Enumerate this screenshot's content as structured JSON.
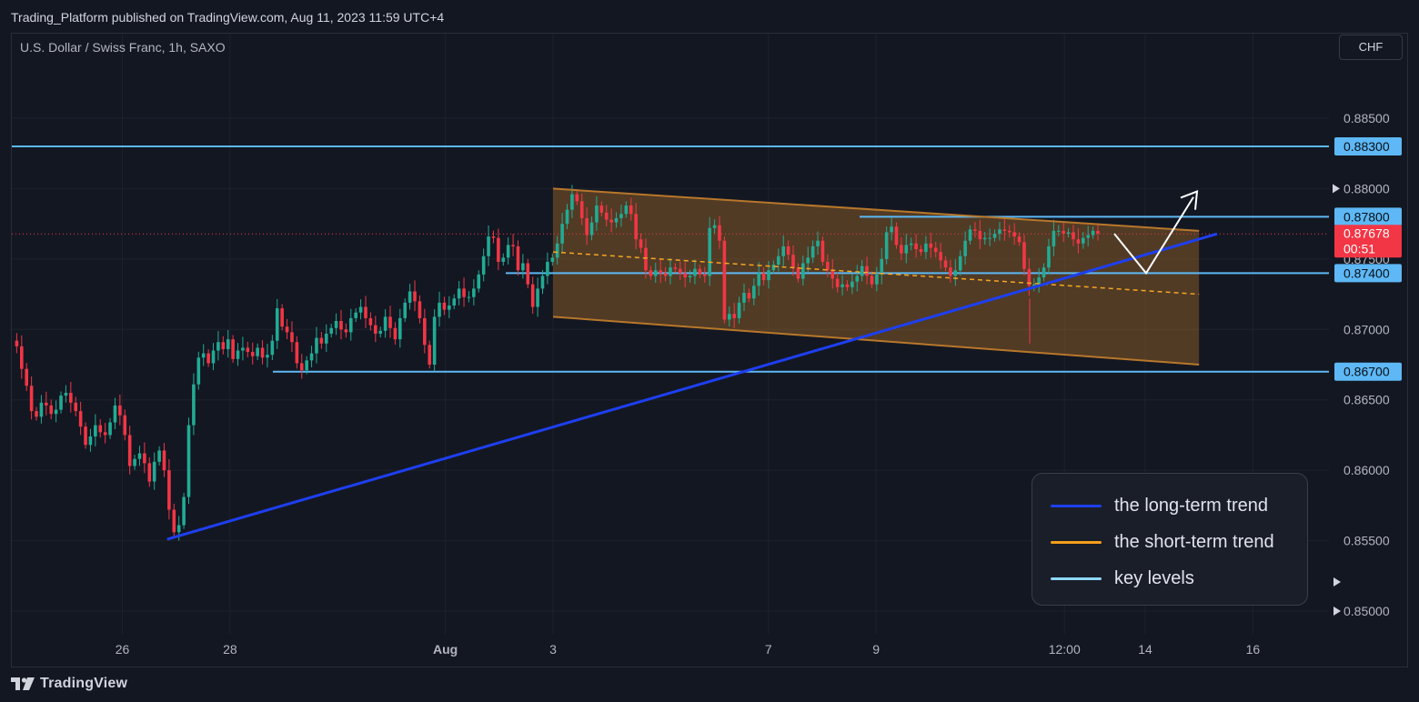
{
  "header": {
    "published_text": "Trading_Platform published on TradingView.com, Aug 11, 2023 11:59 UTC+4",
    "symbol_text": "U.S. Dollar / Swiss Franc, 1h, SAXO",
    "currency_label": "CHF"
  },
  "footer": {
    "brand": "TradingView"
  },
  "legend": {
    "items": [
      {
        "label": "the long-term trend",
        "color": "#1e3ff0"
      },
      {
        "label": "the short-term trend",
        "color": "#f59e1a"
      },
      {
        "label": "key levels",
        "color": "#8fd8ff"
      }
    ]
  },
  "colors": {
    "bull": "#22ab94",
    "bear": "#f23645",
    "key_level": "#5db8f5",
    "trend": "#1e3ff0",
    "channel": "#b8772a",
    "last_price": "#f23645"
  },
  "chart_data": {
    "type": "candlestick",
    "ylim": [
      0.8478,
      0.8897
    ],
    "y_ticks": [
      "0.88500",
      "0.88000",
      "0.87500",
      "0.87000",
      "0.86500",
      "0.86000",
      "0.85500",
      "0.85000"
    ],
    "x_ticks": [
      "26",
      "28",
      "Aug",
      "3",
      "7",
      "9",
      "12:00",
      "14",
      "16"
    ],
    "key_levels": [
      {
        "label": "0.88300",
        "value": 0.883
      },
      {
        "label": "0.87800",
        "value": 0.878
      },
      {
        "label": "0.87400",
        "value": 0.874
      },
      {
        "label": "0.86700",
        "value": 0.867
      }
    ],
    "last_price": {
      "label": "0.87678",
      "countdown": "00:51",
      "value": 0.87678
    },
    "trend_line": {
      "start": [
        "Jul 27",
        0.8551
      ],
      "end": [
        "Aug 14",
        0.8753
      ]
    },
    "channel": {
      "upper": [
        [
          "Aug 3",
          0.88
        ],
        [
          "Aug 15",
          0.877
        ]
      ],
      "lower": [
        [
          "Aug 3",
          0.8709
        ],
        [
          "Aug 15",
          0.8675
        ]
      ],
      "mid": [
        [
          "Aug 3",
          0.8755
        ],
        [
          "Aug 15",
          0.8725
        ]
      ]
    },
    "close_path": [
      0.8692,
      0.8688,
      0.8672,
      0.866,
      0.8642,
      0.8638,
      0.8648,
      0.8646,
      0.864,
      0.8643,
      0.8653,
      0.8655,
      0.8648,
      0.8642,
      0.8631,
      0.8618,
      0.8624,
      0.8632,
      0.8627,
      0.8625,
      0.8634,
      0.8646,
      0.8639,
      0.8625,
      0.8603,
      0.8608,
      0.8612,
      0.8605,
      0.8592,
      0.8606,
      0.8614,
      0.86,
      0.8572,
      0.8556,
      0.8561,
      0.8581,
      0.8632,
      0.8661,
      0.868,
      0.8683,
      0.8676,
      0.8685,
      0.8691,
      0.8686,
      0.8693,
      0.8679,
      0.8685,
      0.8687,
      0.8684,
      0.8681,
      0.8687,
      0.868,
      0.8682,
      0.8692,
      0.8715,
      0.8702,
      0.8698,
      0.8691,
      0.8676,
      0.8671,
      0.8678,
      0.8683,
      0.8694,
      0.869,
      0.8697,
      0.8701,
      0.8706,
      0.87,
      0.8698,
      0.8708,
      0.8712,
      0.8716,
      0.8708,
      0.8703,
      0.8697,
      0.8699,
      0.8709,
      0.8701,
      0.8693,
      0.8708,
      0.8719,
      0.8727,
      0.872,
      0.8708,
      0.8689,
      0.8675,
      0.8709,
      0.8719,
      0.8714,
      0.8717,
      0.8722,
      0.8729,
      0.8723,
      0.8723,
      0.8729,
      0.8739,
      0.8752,
      0.8766,
      0.8765,
      0.8748,
      0.8751,
      0.876,
      0.8759,
      0.8742,
      0.8747,
      0.8732,
      0.8716,
      0.8729,
      0.8738,
      0.8748,
      0.8751,
      0.8761,
      0.8775,
      0.8785,
      0.8796,
      0.8791,
      0.8779,
      0.8767,
      0.8776,
      0.8788,
      0.8783,
      0.8778,
      0.8776,
      0.8779,
      0.8782,
      0.8788,
      0.8782,
      0.8764,
      0.8758,
      0.8742,
      0.8738,
      0.8742,
      0.874,
      0.8738,
      0.8744,
      0.8743,
      0.874,
      0.8737,
      0.8738,
      0.8743,
      0.8739,
      0.8738,
      0.8772,
      0.8774,
      0.8763,
      0.8707,
      0.8711,
      0.8708,
      0.8719,
      0.8726,
      0.8722,
      0.8731,
      0.874,
      0.8735,
      0.8742,
      0.8746,
      0.8752,
      0.8759,
      0.8753,
      0.8744,
      0.8736,
      0.8747,
      0.8751,
      0.8759,
      0.8763,
      0.8748,
      0.8742,
      0.8736,
      0.873,
      0.8732,
      0.873,
      0.8734,
      0.8738,
      0.8745,
      0.8738,
      0.8732,
      0.8739,
      0.875,
      0.8769,
      0.8773,
      0.876,
      0.8754,
      0.876,
      0.8761,
      0.8757,
      0.8755,
      0.8761,
      0.8758,
      0.8755,
      0.8749,
      0.8744,
      0.8738,
      0.8742,
      0.8752,
      0.8763,
      0.8771,
      0.877,
      0.8764,
      0.8765,
      0.8765,
      0.8768,
      0.8771,
      0.877,
      0.8769,
      0.8766,
      0.8762,
      0.8743,
      0.8731,
      0.8732,
      0.8737,
      0.8744,
      0.8759,
      0.877,
      0.877,
      0.8768,
      0.8769,
      0.8764,
      0.8761,
      0.8765,
      0.8767,
      0.877,
      0.8768
    ]
  }
}
